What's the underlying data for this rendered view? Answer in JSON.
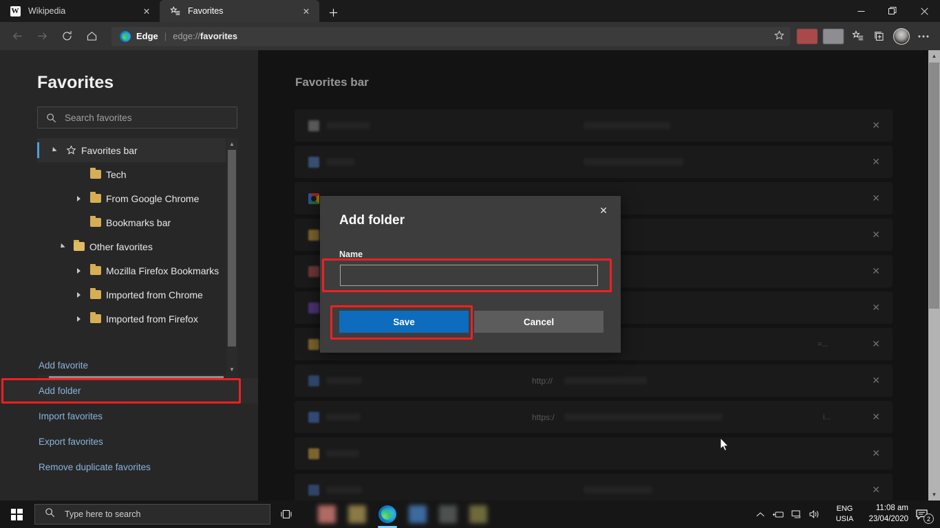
{
  "window": {
    "tabs": [
      {
        "title": "Wikipedia",
        "favicon": "wikipedia-icon",
        "favicon_letter": "W",
        "active": false,
        "close_label": "✕"
      },
      {
        "title": "Favorites",
        "favicon": "favorites-star-list-icon",
        "active": true,
        "close_label": "✕"
      }
    ],
    "new_tab_label": "+",
    "controls": {
      "minimize": "—",
      "maximize": "❐",
      "close": "✕"
    }
  },
  "toolbar": {
    "back_label": "←",
    "forward_label": "→",
    "refresh_label": "↻",
    "home_label": "⌂",
    "omnibox": {
      "scheme_label": "Edge",
      "divider": "|",
      "url_dim": "edge://",
      "url_strong": "favorites",
      "star_label": "☆"
    },
    "favorites_label": "☆",
    "collections_label": "⧉",
    "profile_label": "profile-avatar",
    "settings_label": "⋯"
  },
  "sidebar": {
    "title": "Favorites",
    "search": {
      "placeholder": "Search favorites",
      "value": "",
      "icon": "search-icon"
    },
    "tree": [
      {
        "label": "Favorites bar",
        "indent": 0,
        "expander": "down",
        "icon": "star",
        "selected": true
      },
      {
        "label": "Tech",
        "indent": 1,
        "expander": "none",
        "icon": "folder",
        "selected": false
      },
      {
        "label": "From Google Chrome",
        "indent": 1,
        "expander": "right",
        "icon": "folder",
        "selected": false
      },
      {
        "label": "Bookmarks bar",
        "indent": 1,
        "expander": "none",
        "icon": "folder",
        "selected": false
      },
      {
        "label": "Other favorites",
        "indent": 0,
        "expander": "down",
        "icon": "folder-open",
        "selected": false
      },
      {
        "label": "Mozilla Firefox Bookmarks",
        "indent": 1,
        "expander": "right",
        "icon": "folder",
        "selected": false
      },
      {
        "label": "Imported from Chrome",
        "indent": 1,
        "expander": "right",
        "icon": "folder",
        "selected": false
      },
      {
        "label": "Imported from Firefox",
        "indent": 1,
        "expander": "right",
        "icon": "folder",
        "selected": false
      }
    ],
    "links": [
      {
        "label": "Add favorite",
        "highlighted": false
      },
      {
        "label": "Add folder",
        "highlighted": true
      },
      {
        "label": "Import favorites",
        "highlighted": false
      },
      {
        "label": "Export favorites",
        "highlighted": false
      },
      {
        "label": "Remove duplicate favorites",
        "highlighted": false
      }
    ]
  },
  "main": {
    "title": "Favorites bar",
    "rows": [
      {
        "icon_color": "#8e8e8e",
        "name_width": 64,
        "url_prefix": "",
        "url_width": 126,
        "remove_label": "✕"
      },
      {
        "icon_color": "#5b7fb5",
        "name_width": 42,
        "url_prefix": "",
        "url_width": 145,
        "remove_label": "✕"
      },
      {
        "icon_color": "google",
        "name_width": 0,
        "url_prefix": "",
        "url_width": 0,
        "remove_label": "✕"
      },
      {
        "icon_color": "#c9a24a",
        "name_width": 48,
        "url_prefix": "",
        "url_width": 0,
        "remove_label": "✕"
      },
      {
        "icon_color": "#b35a5a",
        "name_width": 38,
        "url_prefix": "",
        "url_width": 0,
        "remove_label": "✕"
      },
      {
        "icon_color": "#7a52b8",
        "name_width": 40,
        "url_prefix": "",
        "url_width": 0,
        "remove_label": "✕"
      },
      {
        "icon_color": "#c9a24a",
        "name_width": 44,
        "url_prefix": "",
        "url_width": 0,
        "remove_label": "✕",
        "trail": "=..."
      },
      {
        "icon_color": "#4b6fa8",
        "name_width": 52,
        "url_prefix": "http://",
        "url_width": 120,
        "remove_label": "✕"
      },
      {
        "icon_color": "#4f78bd",
        "name_width": 50,
        "url_prefix": "https:/",
        "url_width": 230,
        "remove_label": "✕",
        "trail": "i..."
      },
      {
        "icon_color": "#c9a24a",
        "name_width": 48,
        "url_prefix": "",
        "url_width": 0,
        "remove_label": "✕"
      },
      {
        "icon_color": "#4b6fa8",
        "name_width": 52,
        "url_prefix": "",
        "url_width": 100,
        "remove_label": "✕"
      }
    ]
  },
  "dialog": {
    "title": "Add folder",
    "close_label": "✕",
    "name_label": "Name",
    "name_value": "",
    "name_placeholder": "",
    "save_label": "Save",
    "cancel_label": "Cancel"
  },
  "highlight": {
    "color": "#f41f1f"
  },
  "taskbar": {
    "start_label": "windows-start-icon",
    "search": {
      "placeholder": "Type here to search",
      "icon": "search-icon"
    },
    "task_view_label": "task-view-icon",
    "tray": {
      "chevron_label": "∧",
      "hardware_label": "hardware-safe-removal-icon",
      "network_label": "network-icon",
      "volume_label": "volume-icon",
      "language_line1": "ENG",
      "language_line2": "USIA",
      "time": "11:08 am",
      "date": "23/04/2020",
      "notifications_count": "2"
    }
  },
  "colors": {
    "accent_blue": "#0d6cbd",
    "link_blue": "#8ab4dd",
    "highlight_red": "#f41f1f",
    "window_bg": "#202020",
    "sidebar_bg": "#272727",
    "dialog_bg": "#3d3d3d"
  }
}
